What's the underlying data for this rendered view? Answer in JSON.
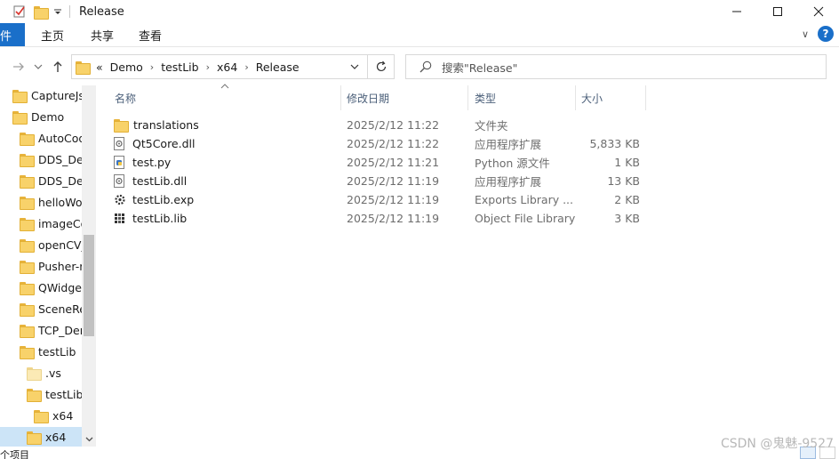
{
  "window": {
    "title": "Release",
    "controls": {
      "minimize": "—",
      "maximize": "☐",
      "close": "✕"
    }
  },
  "ribbon": {
    "file_tab": "件",
    "tabs": [
      "主页",
      "共享",
      "查看"
    ],
    "help": "?",
    "expand": "∨"
  },
  "nav": {
    "back": "→",
    "recent": "∨",
    "up": "↑"
  },
  "address": {
    "overflow": "«",
    "crumbs": [
      "Demo",
      "testLib",
      "x64",
      "Release"
    ],
    "separator": "›",
    "dropdown": "∨",
    "refresh": "↻"
  },
  "search": {
    "placeholder": "搜索\"Release\""
  },
  "tree": [
    {
      "label": "CaptureJs",
      "indent": 0,
      "light": false
    },
    {
      "label": "Demo",
      "indent": 0,
      "light": false
    },
    {
      "label": "AutoCod",
      "indent": 1,
      "light": false
    },
    {
      "label": "DDS_Der",
      "indent": 1,
      "light": false
    },
    {
      "label": "DDS_Der",
      "indent": 1,
      "light": false
    },
    {
      "label": "helloWo",
      "indent": 1,
      "light": false
    },
    {
      "label": "imageCo",
      "indent": 1,
      "light": false
    },
    {
      "label": "openCV_",
      "indent": 1,
      "light": false
    },
    {
      "label": "Pusher-r",
      "indent": 1,
      "light": false
    },
    {
      "label": "QWidget",
      "indent": 1,
      "light": false
    },
    {
      "label": "SceneRe",
      "indent": 1,
      "light": false
    },
    {
      "label": "TCP_Den",
      "indent": 1,
      "light": false
    },
    {
      "label": "testLib",
      "indent": 1,
      "light": false
    },
    {
      "label": ".vs",
      "indent": 2,
      "light": true
    },
    {
      "label": "testLib",
      "indent": 2,
      "light": false
    },
    {
      "label": "x64",
      "indent": 3,
      "light": false
    },
    {
      "label": "x64",
      "indent": 2,
      "light": false,
      "selected": true
    }
  ],
  "columns": {
    "name": "名称",
    "date": "修改日期",
    "type": "类型",
    "size": "大小"
  },
  "files": [
    {
      "name": "translations",
      "date": "2025/2/12 11:22",
      "type": "文件夹",
      "size": "",
      "icon": "folder-icon"
    },
    {
      "name": "Qt5Core.dll",
      "date": "2025/2/12 11:22",
      "type": "应用程序扩展",
      "size": "5,833 KB",
      "icon": "dll-file-icon"
    },
    {
      "name": "test.py",
      "date": "2025/2/12 11:21",
      "type": "Python 源文件",
      "size": "1 KB",
      "icon": "python-file-icon"
    },
    {
      "name": "testLib.dll",
      "date": "2025/2/12 11:19",
      "type": "应用程序扩展",
      "size": "13 KB",
      "icon": "dll-file-icon"
    },
    {
      "name": "testLib.exp",
      "date": "2025/2/12 11:19",
      "type": "Exports Library ...",
      "size": "2 KB",
      "icon": "exp-file-icon"
    },
    {
      "name": "testLib.lib",
      "date": "2025/2/12 11:19",
      "type": "Object File Library",
      "size": "3 KB",
      "icon": "lib-file-icon"
    }
  ],
  "status": {
    "text": "个项目"
  },
  "watermark": "CSDN @鬼魅-9527"
}
